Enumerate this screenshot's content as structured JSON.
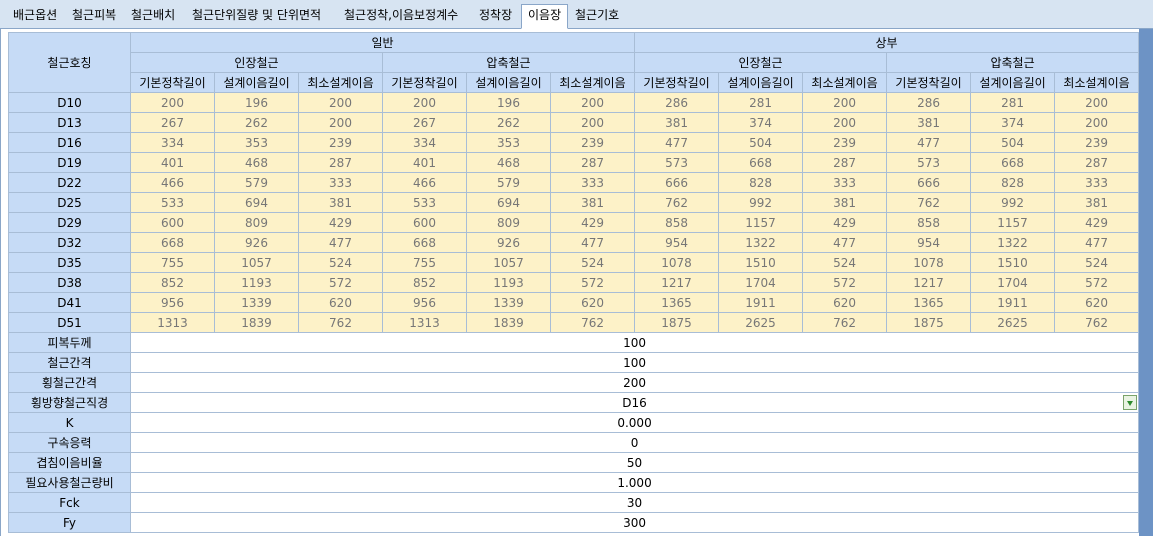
{
  "tabs": [
    {
      "label": "배근옵션",
      "active": false
    },
    {
      "label": "철근피복",
      "active": false
    },
    {
      "label": "철근배치",
      "active": false
    },
    {
      "label": "철근단위질량 및 단위면적",
      "active": false
    },
    {
      "label": "철근정착,이음보정계수",
      "active": false
    },
    {
      "label": "정착장",
      "active": false
    },
    {
      "label": "이음장",
      "active": true
    },
    {
      "label": "철근기호",
      "active": false
    }
  ],
  "header": {
    "corner": "철근호칭",
    "groups": [
      "일반",
      "상부"
    ],
    "subgroups": [
      "인장철근",
      "압축철근",
      "인장철근",
      "압축철근"
    ],
    "columns": [
      "기본정착길이",
      "설계이음길이",
      "최소설계이음",
      "기본정착길이",
      "설계이음길이",
      "최소설계이음",
      "기본정착길이",
      "설계이음길이",
      "최소설계이음",
      "기본정착길이",
      "설계이음길이",
      "최소설계이음"
    ]
  },
  "rows": [
    {
      "bar": "D10",
      "values": [
        "200",
        "196",
        "200",
        "200",
        "196",
        "200",
        "286",
        "281",
        "200",
        "286",
        "281",
        "200"
      ]
    },
    {
      "bar": "D13",
      "values": [
        "267",
        "262",
        "200",
        "267",
        "262",
        "200",
        "381",
        "374",
        "200",
        "381",
        "374",
        "200"
      ]
    },
    {
      "bar": "D16",
      "values": [
        "334",
        "353",
        "239",
        "334",
        "353",
        "239",
        "477",
        "504",
        "239",
        "477",
        "504",
        "239"
      ]
    },
    {
      "bar": "D19",
      "values": [
        "401",
        "468",
        "287",
        "401",
        "468",
        "287",
        "573",
        "668",
        "287",
        "573",
        "668",
        "287"
      ]
    },
    {
      "bar": "D22",
      "values": [
        "466",
        "579",
        "333",
        "466",
        "579",
        "333",
        "666",
        "828",
        "333",
        "666",
        "828",
        "333"
      ]
    },
    {
      "bar": "D25",
      "values": [
        "533",
        "694",
        "381",
        "533",
        "694",
        "381",
        "762",
        "992",
        "381",
        "762",
        "992",
        "381"
      ]
    },
    {
      "bar": "D29",
      "values": [
        "600",
        "809",
        "429",
        "600",
        "809",
        "429",
        "858",
        "1157",
        "429",
        "858",
        "1157",
        "429"
      ]
    },
    {
      "bar": "D32",
      "values": [
        "668",
        "926",
        "477",
        "668",
        "926",
        "477",
        "954",
        "1322",
        "477",
        "954",
        "1322",
        "477"
      ]
    },
    {
      "bar": "D35",
      "values": [
        "755",
        "1057",
        "524",
        "755",
        "1057",
        "524",
        "1078",
        "1510",
        "524",
        "1078",
        "1510",
        "524"
      ]
    },
    {
      "bar": "D38",
      "values": [
        "852",
        "1193",
        "572",
        "852",
        "1193",
        "572",
        "1217",
        "1704",
        "572",
        "1217",
        "1704",
        "572"
      ]
    },
    {
      "bar": "D41",
      "values": [
        "956",
        "1339",
        "620",
        "956",
        "1339",
        "620",
        "1365",
        "1911",
        "620",
        "1365",
        "1911",
        "620"
      ]
    },
    {
      "bar": "D51",
      "values": [
        "1313",
        "1839",
        "762",
        "1313",
        "1839",
        "762",
        "1875",
        "2625",
        "762",
        "1875",
        "2625",
        "762"
      ]
    }
  ],
  "params": [
    {
      "label": "피복두께",
      "value": "100"
    },
    {
      "label": "철근간격",
      "value": "100"
    },
    {
      "label": "횡철근간격",
      "value": "200"
    },
    {
      "label": "횡방향철근직경",
      "value": "D16",
      "combo": true
    },
    {
      "label": "K",
      "value": "0.000"
    },
    {
      "label": "구속응력",
      "value": "0"
    },
    {
      "label": "겹침이음비율",
      "value": "50"
    },
    {
      "label": "필요사용철근량비",
      "value": "1.000"
    },
    {
      "label": "Fck",
      "value": "30"
    },
    {
      "label": "Fy",
      "value": "300"
    }
  ],
  "colors": {
    "header_bg": "#c6dbf6",
    "cell_bg": "#fdf2c8",
    "cell_text": "#777777",
    "grid_line": "#a8bdd6",
    "tab_bg": "#d7e4f2",
    "scroll_strip": "#6d93c5"
  }
}
